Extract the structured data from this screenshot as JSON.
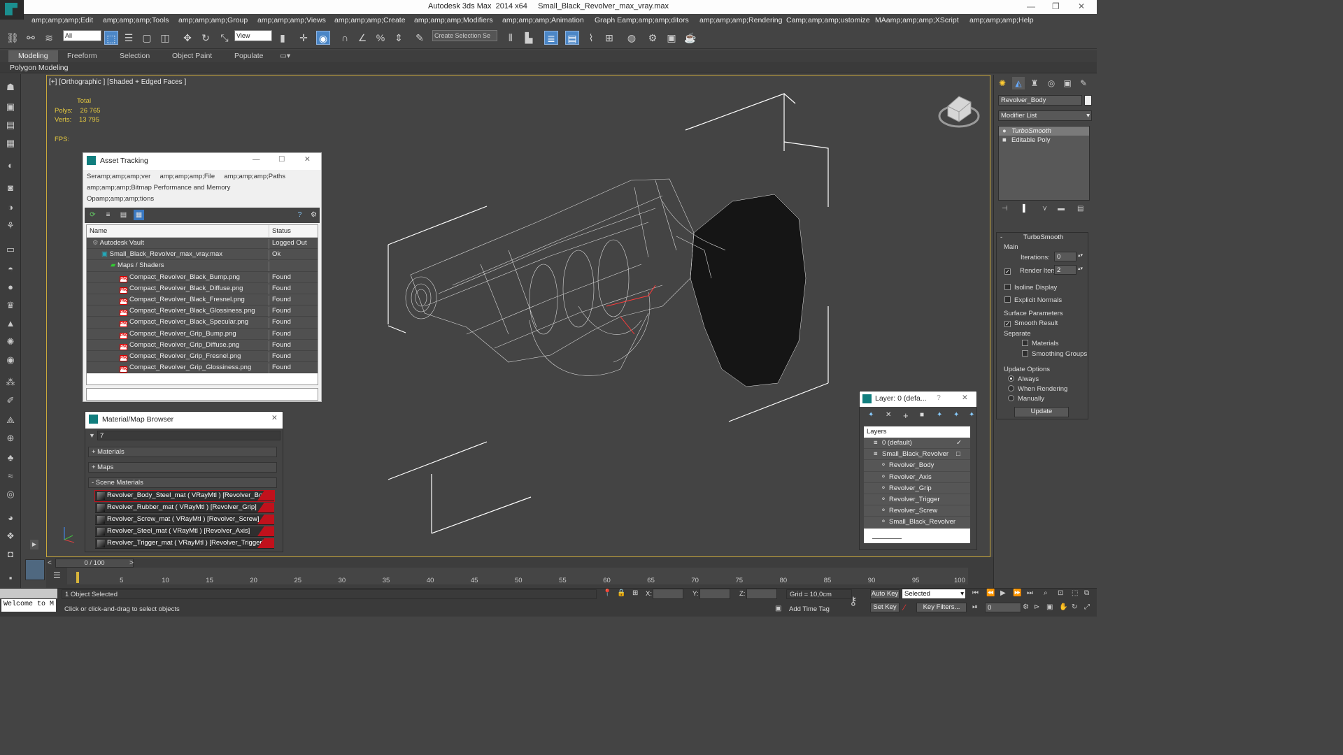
{
  "app": {
    "title": "Autodesk 3ds Max  2014 x64     Small_Black_Revolver_max_vray.max"
  },
  "menu": [
    "amp;amp;amp;Edit",
    "amp;amp;amp;Tools",
    "amp;amp;amp;Group",
    "amp;amp;amp;Views",
    "amp;amp;amp;Create",
    "amp;amp;amp;Modifiers",
    "amp;amp;amp;Animation",
    "Graph Eamp;amp;amp;ditors",
    "amp;amp;amp;Rendering",
    "Camp;amp;amp;ustomize",
    "MAamp;amp;amp;XScript",
    "amp;amp;amp;Help"
  ],
  "toolbar": {
    "filter_select": "All",
    "ref_coord_select": "View",
    "selection_set": "Create Selection Se"
  },
  "ribbon": {
    "tabs": [
      "Modeling",
      "Freeform",
      "Selection",
      "Object Paint",
      "Populate"
    ],
    "panel_label": "Polygon Modeling"
  },
  "viewport": {
    "label": "[+] [Orthographic ] [Shaded + Edged Faces ]",
    "stats_total": "Total",
    "polys_label": "Polys:",
    "polys_value": "26 765",
    "verts_label": "Verts:",
    "verts_value": "13 795",
    "fps_label": "FPS:"
  },
  "asset_tracking": {
    "title": "Asset Tracking",
    "menu_line1": "Seramp;amp;amp;ver     amp;amp;amp;File     amp;amp;amp;Paths",
    "menu_line2": "amp;amp;amp;Bitmap Performance and Memory",
    "menu_line3": "Opamp;amp;amp;tions",
    "col_name": "Name",
    "col_status": "Status",
    "rows": [
      {
        "name": "Autodesk Vault",
        "status": "Logged Out",
        "indent": 0,
        "kind": "vault"
      },
      {
        "name": "Small_Black_Revolver_max_vray.max",
        "status": "Ok",
        "indent": 1,
        "kind": "max"
      },
      {
        "name": "Maps / Shaders",
        "status": "",
        "indent": 2,
        "kind": "folder"
      },
      {
        "name": "Compact_Revolver_Black_Bump.png",
        "status": "Found",
        "indent": 3,
        "kind": "png"
      },
      {
        "name": "Compact_Revolver_Black_Diffuse.png",
        "status": "Found",
        "indent": 3,
        "kind": "png"
      },
      {
        "name": "Compact_Revolver_Black_Fresnel.png",
        "status": "Found",
        "indent": 3,
        "kind": "png"
      },
      {
        "name": "Compact_Revolver_Black_Glossiness.png",
        "status": "Found",
        "indent": 3,
        "kind": "png"
      },
      {
        "name": "Compact_Revolver_Black_Specular.png",
        "status": "Found",
        "indent": 3,
        "kind": "png"
      },
      {
        "name": "Compact_Revolver_Grip_Bump.png",
        "status": "Found",
        "indent": 3,
        "kind": "png"
      },
      {
        "name": "Compact_Revolver_Grip_Diffuse.png",
        "status": "Found",
        "indent": 3,
        "kind": "png"
      },
      {
        "name": "Compact_Revolver_Grip_Fresnel.png",
        "status": "Found",
        "indent": 3,
        "kind": "png"
      },
      {
        "name": "Compact_Revolver_Grip_Glossiness.png",
        "status": "Found",
        "indent": 3,
        "kind": "png"
      }
    ]
  },
  "material_browser": {
    "title": "Material/Map Browser",
    "search_value": "7",
    "cat_materials": "+ Materials",
    "cat_maps": "+ Maps",
    "cat_scene": "- Scene Materials",
    "items": [
      "Revolver_Body_Steel_mat ( VRayMtl ) [Revolver_Body]",
      "Revolver_Rubber_mat ( VRayMtl ) [Revolver_Grip]",
      "Revolver_Screw_mat ( VRayMtl ) [Revolver_Screw]",
      "Revolver_Steel_mat ( VRayMtl ) [Revolver_Axis]",
      "Revolver_Trigger_mat ( VRayMtl ) [Revolver_Trigger]"
    ]
  },
  "layer_dialog": {
    "title": "Layer: 0 (defa...",
    "help": "?",
    "header": "Layers",
    "rows": [
      {
        "name": "0 (default)",
        "indent": 0,
        "mark": "✓"
      },
      {
        "name": "Small_Black_Revolver",
        "indent": 0,
        "mark": "□"
      },
      {
        "name": "Revolver_Body",
        "indent": 1,
        "mark": ""
      },
      {
        "name": "Revolver_Axis",
        "indent": 1,
        "mark": ""
      },
      {
        "name": "Revolver_Grip",
        "indent": 1,
        "mark": ""
      },
      {
        "name": "Revolver_Trigger",
        "indent": 1,
        "mark": ""
      },
      {
        "name": "Revolver_Screw",
        "indent": 1,
        "mark": ""
      },
      {
        "name": "Small_Black_Revolver",
        "indent": 1,
        "mark": ""
      }
    ]
  },
  "command_panel": {
    "object_name": "Revolver_Body",
    "modifier_list": "Modifier List",
    "stack": [
      "TurboSmooth",
      "Editable Poly"
    ],
    "rollout_title": "TurboSmooth",
    "main_label": "Main",
    "iterations_label": "Iterations:",
    "iterations_value": "0",
    "render_iters_label": "Render Iters:",
    "render_iters_value": "2",
    "isoline": "Isoline Display",
    "explicit": "Explicit Normals",
    "surface_params": "Surface Parameters",
    "smooth_result": "Smooth Result",
    "separate": "Separate",
    "materials": "Materials",
    "smoothing_groups": "Smoothing Groups",
    "update_options": "Update Options",
    "always": "Always",
    "when_rendering": "When Rendering",
    "manually": "Manually",
    "update_btn": "Update"
  },
  "timeline": {
    "slider": "0 / 100",
    "ticks": [
      "0",
      "5",
      "10",
      "15",
      "20",
      "25",
      "30",
      "35",
      "40",
      "45",
      "50",
      "55",
      "60",
      "65",
      "70",
      "75",
      "80",
      "85",
      "90",
      "95",
      "100"
    ]
  },
  "status": {
    "welcome": "Welcome to M",
    "selected": "1 Object Selected",
    "prompt": "Click or click-and-drag to select objects",
    "x_label": "X:",
    "y_label": "Y:",
    "z_label": "Z:",
    "grid": "Grid = 10,0cm",
    "add_time_tag": "Add Time Tag",
    "auto_key": "Auto Key",
    "set_key": "Set Key",
    "key_mode": "Selected",
    "key_filters": "Key Filters...",
    "frame": "0"
  }
}
